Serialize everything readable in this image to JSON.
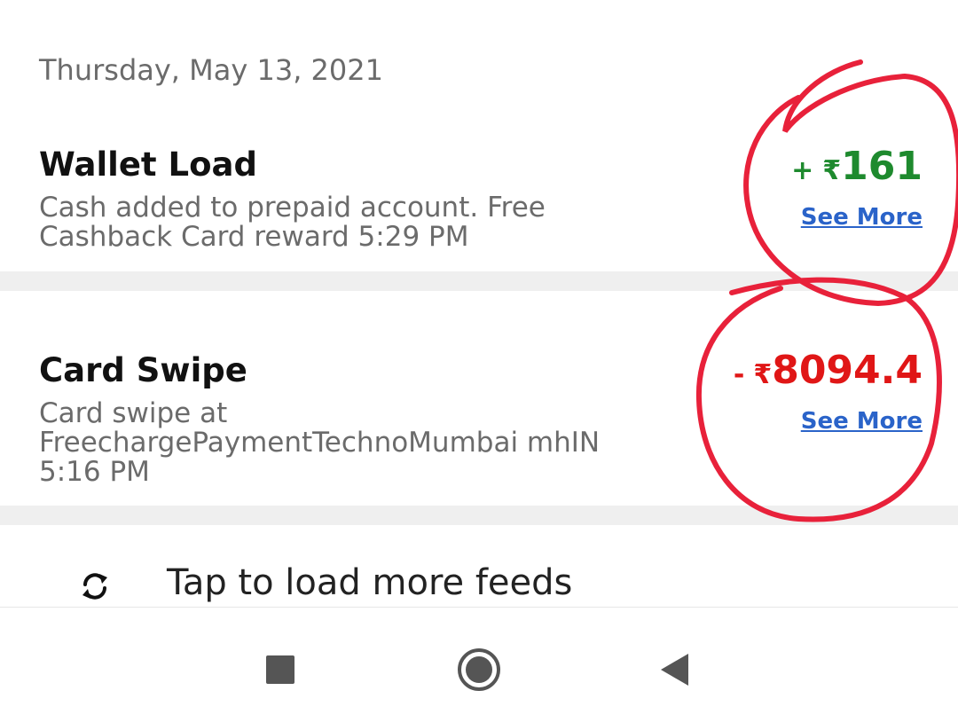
{
  "date_header": "Thursday, May 13, 2021",
  "transactions": [
    {
      "title": "Wallet Load",
      "description": "Cash added to prepaid account. Free Cashback Card reward 5:29 PM",
      "sign": "+",
      "currency": "₹",
      "amount": "161",
      "type": "credit",
      "see_more": "See More"
    },
    {
      "title": "Card Swipe",
      "description": "Card swipe at FreechargePaymentTechnoMumbai mhIN 5:16 PM",
      "sign": "-",
      "currency": "₹",
      "amount": "8094.4",
      "type": "debit",
      "see_more": "See More"
    }
  ],
  "load_more": {
    "label": "Tap to load more feeds",
    "icon": "refresh-icon"
  },
  "navbar": {
    "icons": [
      "recents-square-icon",
      "home-circle-icon",
      "back-triangle-icon"
    ]
  },
  "colors": {
    "credit": "#1e8a2e",
    "debit": "#e01616",
    "link": "#2a63c9",
    "annotation": "#e8213a"
  }
}
